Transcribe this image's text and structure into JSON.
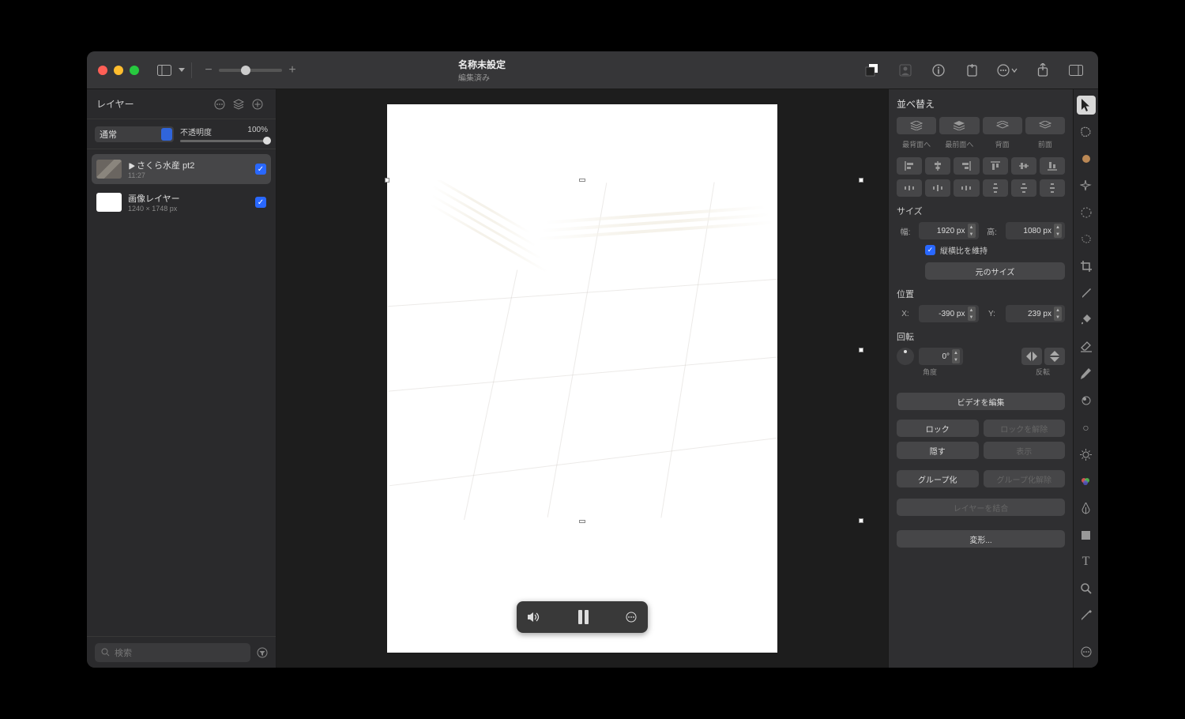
{
  "titlebar": {
    "title": "名称未設定",
    "subtitle": "編集済み"
  },
  "left_panel": {
    "header": "レイヤー",
    "blend_mode": "通常",
    "opacity_label": "不透明度",
    "opacity_value": "100%",
    "layers": [
      {
        "name": "さくら水産 pt2",
        "sub": "11:27",
        "type": "video"
      },
      {
        "name": "画像レイヤー",
        "sub": "1240 × 1748 px",
        "type": "image"
      }
    ],
    "search_placeholder": "検索"
  },
  "inspector": {
    "arrange_title": "並べ替え",
    "depth_labels": [
      "最背面へ",
      "最前面へ",
      "背面",
      "前面"
    ],
    "size_title": "サイズ",
    "width_label": "幅:",
    "width_value": "1920 px",
    "height_label": "高:",
    "height_value": "1080 px",
    "aspect_label": "縦横比を維持",
    "original_size_btn": "元のサイズ",
    "position_title": "位置",
    "x_label": "X:",
    "x_value": "-390 px",
    "y_label": "Y:",
    "y_value": "239 px",
    "rotation_title": "回転",
    "angle_value": "0°",
    "angle_label": "角度",
    "flip_label": "反転",
    "edit_video_btn": "ビデオを編集",
    "lock_btn": "ロック",
    "unlock_btn": "ロックを解除",
    "hide_btn": "隠す",
    "show_btn": "表示",
    "group_btn": "グループ化",
    "ungroup_btn": "グループ化解除",
    "merge_btn": "レイヤーを結合",
    "transform_btn": "変形..."
  }
}
